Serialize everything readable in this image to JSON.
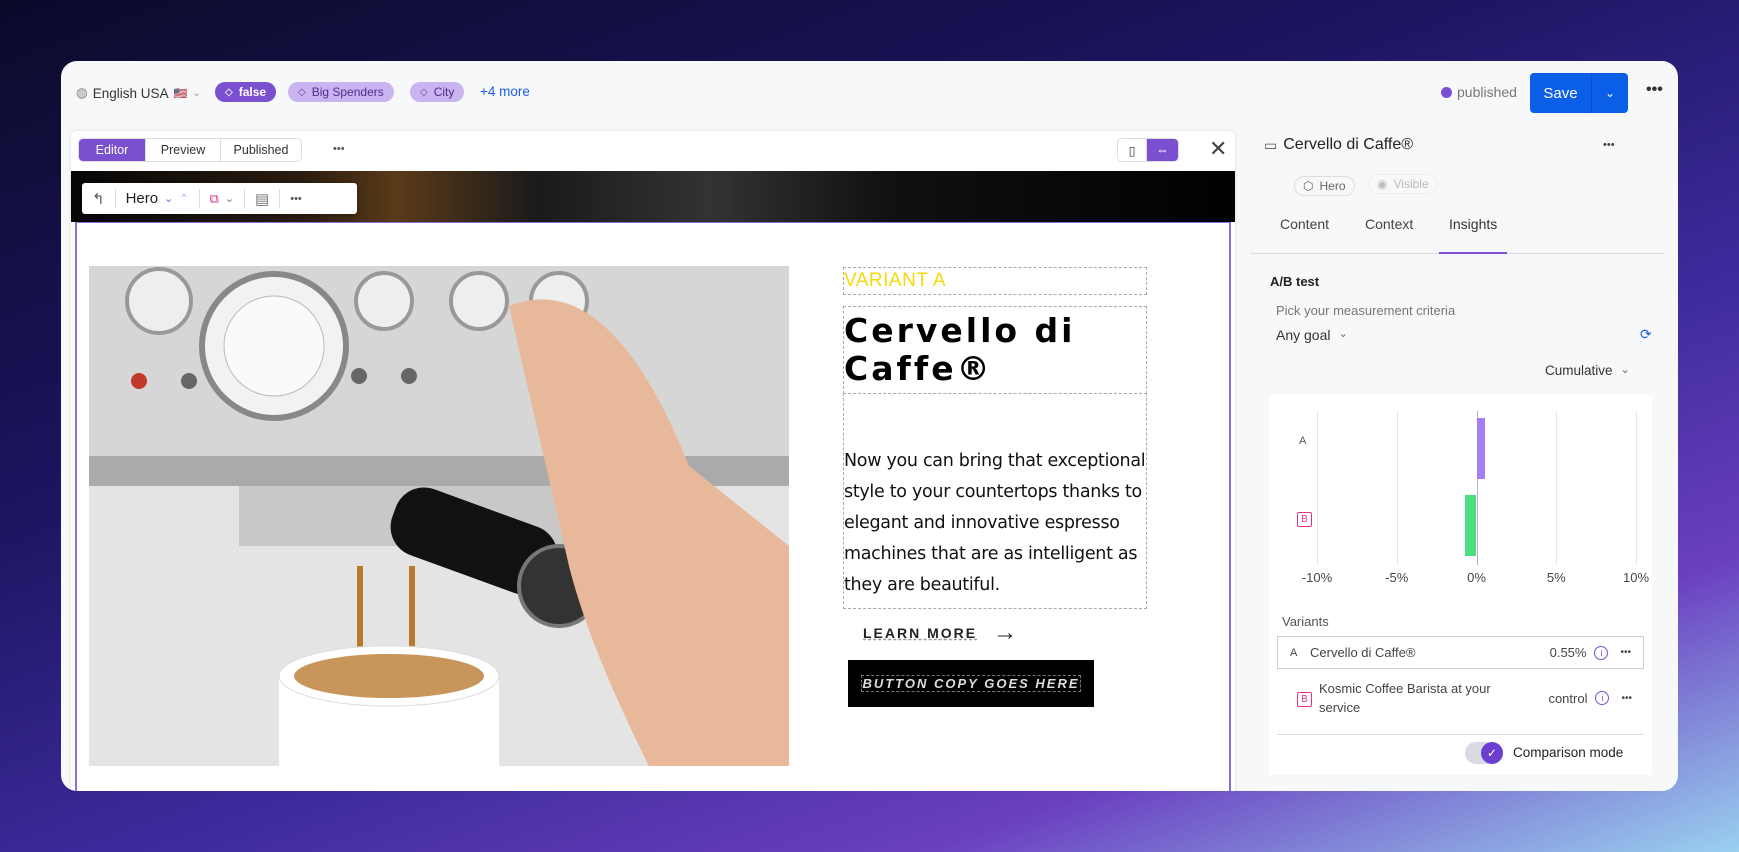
{
  "topbar": {
    "locale": "English USA",
    "flag": "🇺🇸",
    "pills": [
      {
        "label": "false"
      },
      {
        "label": "Big Spenders"
      },
      {
        "label": "City"
      }
    ],
    "more": "+4 more",
    "status": "published",
    "status_color": "#7a4fd0",
    "save": "Save"
  },
  "editor": {
    "tabs": [
      {
        "label": "Editor",
        "active": true
      },
      {
        "label": "Preview"
      },
      {
        "label": "Published"
      }
    ],
    "toolbar": {
      "component": "Hero"
    }
  },
  "hero": {
    "eyebrow": "VARIANT A",
    "heading": "Cervello di Caffe®",
    "body": "Now you can bring that exceptional style to your countertops thanks to elegant and innovative espresso machines that are as intelligent as they are beautiful.",
    "link": "LEARN MORE",
    "button": "BUTTON COPY GOES HERE"
  },
  "panel": {
    "title": "Cervello di Caffe®",
    "type_badge": "Hero",
    "visibility_badge": "Visible",
    "tabs": [
      {
        "label": "Content"
      },
      {
        "label": "Context"
      },
      {
        "label": "Insights",
        "active": true
      }
    ],
    "section": "A/B test",
    "criteria_label": "Pick your measurement criteria",
    "goal": "Any goal",
    "mode": "Cumulative",
    "variants_label": "Variants",
    "variants": [
      {
        "key": "A",
        "name": "Cervello di Caffe®",
        "value": "0.55%"
      },
      {
        "key": "B",
        "name": "Kosmic Coffee Barista at your service",
        "value": "control"
      }
    ],
    "comparison_label": "Comparison mode",
    "comparison_on": true
  },
  "chart_data": {
    "type": "bar",
    "orientation": "horizontal",
    "categories": [
      "A",
      "B"
    ],
    "values": [
      0.55,
      -0.7
    ],
    "colors": [
      "#a77ef5",
      "#4ade80"
    ],
    "xlim": [
      -10,
      10
    ],
    "ticks": [
      "-10%",
      "-5%",
      "0%",
      "5%",
      "10%"
    ],
    "tick_values": [
      -10,
      -5,
      0,
      5,
      10
    ],
    "grid": true
  }
}
